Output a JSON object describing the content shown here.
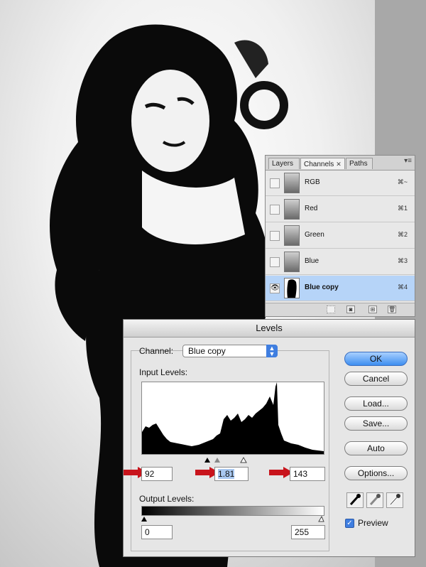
{
  "channels_panel": {
    "tabs": [
      {
        "label": "Layers"
      },
      {
        "label": "Channels",
        "close": "✕"
      },
      {
        "label": "Paths"
      }
    ],
    "rows": [
      {
        "name": "RGB",
        "shortcut": "⌘~",
        "visible": false
      },
      {
        "name": "Red",
        "shortcut": "⌘1",
        "visible": false
      },
      {
        "name": "Green",
        "shortcut": "⌘2",
        "visible": false
      },
      {
        "name": "Blue",
        "shortcut": "⌘3",
        "visible": false
      },
      {
        "name": "Blue copy",
        "shortcut": "⌘4",
        "visible": true,
        "selected": true
      }
    ],
    "footer_icons": [
      "load-selection-icon",
      "save-selection-icon",
      "new-channel-icon",
      "trash-icon"
    ]
  },
  "levels": {
    "title": "Levels",
    "channel_label": "Channel:",
    "channel_value": "Blue copy",
    "input_levels_label": "Input Levels:",
    "input_black": "92",
    "input_gamma": "1.81",
    "input_white": "143",
    "output_levels_label": "Output Levels:",
    "output_black": "0",
    "output_white": "255",
    "buttons": {
      "ok": "OK",
      "cancel": "Cancel",
      "load": "Load...",
      "save": "Save...",
      "auto": "Auto",
      "options": "Options..."
    },
    "preview_label": "Preview",
    "preview_checked": true,
    "eyedroppers": [
      "black-eyedropper-icon",
      "gray-eyedropper-icon",
      "white-eyedropper-icon"
    ]
  },
  "colors": {
    "accent_blue": "#3f7ee0",
    "selection_blue": "#b6d4f8",
    "annotation_red": "#c8141c"
  }
}
